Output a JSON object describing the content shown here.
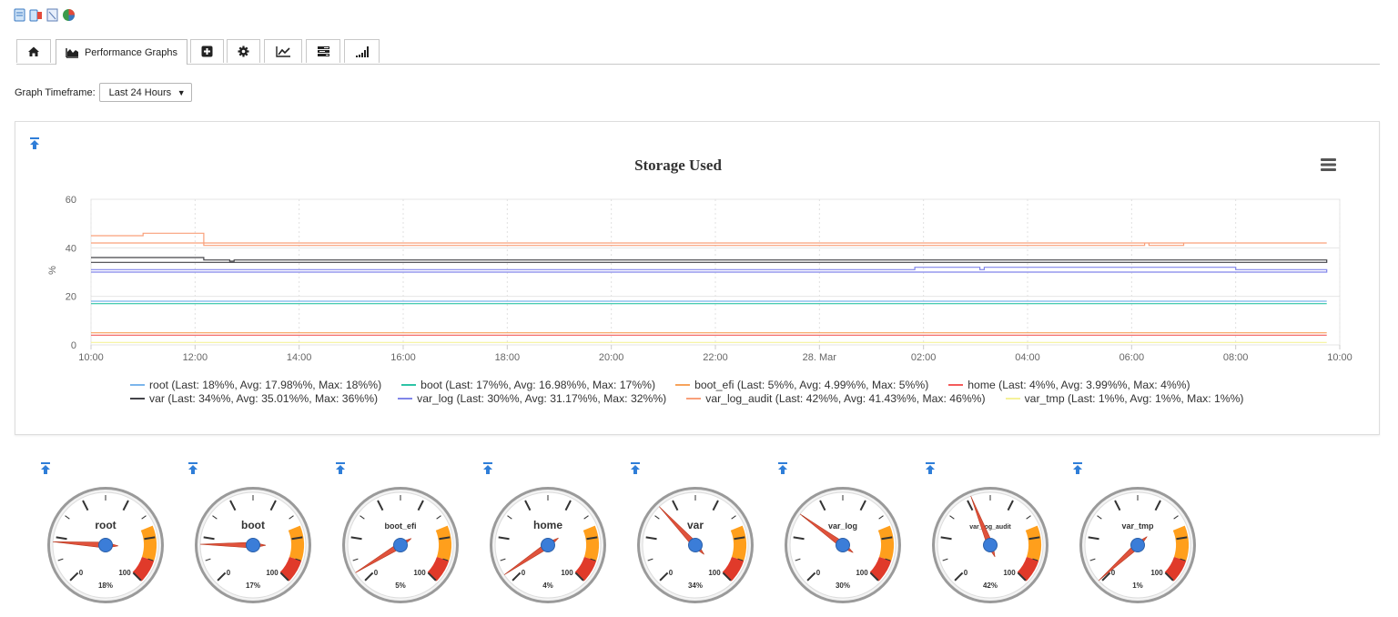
{
  "tabs": [
    {
      "icon": "home-icon",
      "label": ""
    },
    {
      "icon": "area-chart-icon",
      "label": "Performance Graphs"
    },
    {
      "icon": "plus-square-icon",
      "label": ""
    },
    {
      "icon": "gear-icon",
      "label": ""
    },
    {
      "icon": "line-chart-icon",
      "label": ""
    },
    {
      "icon": "tasks-icon",
      "label": ""
    },
    {
      "icon": "signal-bars-icon",
      "label": ""
    }
  ],
  "timeframe": {
    "label": "Graph Timeframe:",
    "selected": "Last 24 Hours"
  },
  "chart_data": [
    {
      "type": "line",
      "title": "Storage Used",
      "xlabel": "",
      "ylabel": "%",
      "ylim": [
        0,
        60
      ],
      "yticks": [
        "0",
        "20",
        "40",
        "60"
      ],
      "xticks": [
        "10:00",
        "12:00",
        "14:00",
        "16:00",
        "18:00",
        "20:00",
        "22:00",
        "28. Mar",
        "02:00",
        "04:00",
        "06:00",
        "08:00",
        "10:00"
      ],
      "x": [
        "10:00",
        "10:45",
        "11:00",
        "11:10",
        "12:00",
        "12:10",
        "12:15",
        "12:40",
        "12:45",
        "13:00",
        "14:00",
        "16:00",
        "18:00",
        "20:00",
        "22:00",
        "00:00",
        "01:45",
        "01:50",
        "02:00",
        "03:00",
        "03:05",
        "03:10",
        "03:15",
        "04:00",
        "06:00",
        "06:15",
        "06:20",
        "06:30",
        "06:45",
        "07:00",
        "07:15",
        "08:00",
        "09:45",
        "10:00",
        "10:15"
      ],
      "series": [
        {
          "name": "root",
          "color": "#7cb5ec",
          "values": [
            18,
            18,
            18,
            18,
            18,
            18,
            18,
            18,
            18,
            18,
            18,
            18,
            18,
            18,
            18,
            18,
            18,
            18,
            18,
            18,
            18,
            18,
            18,
            18,
            18,
            18,
            18,
            18,
            18,
            18,
            18,
            18,
            18,
            18,
            18
          ]
        },
        {
          "name": "boot",
          "color": "#2ec4a6",
          "values": [
            17,
            17,
            17,
            17,
            17,
            17,
            17,
            17,
            17,
            17,
            17,
            17,
            17,
            17,
            17,
            17,
            17,
            17,
            17,
            17,
            17,
            17,
            17,
            17,
            17,
            17,
            17,
            17,
            17,
            17,
            17,
            17,
            17,
            17,
            17
          ]
        },
        {
          "name": "boot_efi",
          "color": "#f7a35c",
          "values": [
            5,
            5,
            5,
            5,
            5,
            5,
            5,
            5,
            5,
            5,
            5,
            5,
            5,
            5,
            5,
            5,
            5,
            5,
            5,
            5,
            5,
            5,
            5,
            5,
            5,
            5,
            5,
            5,
            5,
            5,
            5,
            5,
            5,
            5,
            5
          ]
        },
        {
          "name": "home",
          "color": "#f45b5b",
          "values": [
            4,
            4,
            4,
            4,
            4,
            4,
            4,
            4,
            4,
            4,
            4,
            4,
            4,
            4,
            4,
            4,
            4,
            4,
            4,
            4,
            4,
            4,
            4,
            4,
            4,
            4,
            4,
            4,
            4,
            4,
            4,
            4,
            4,
            4,
            4
          ]
        },
        {
          "name": "var",
          "color": "#434348",
          "values": [
            36,
            36,
            36,
            36,
            36,
            35,
            35,
            34.5,
            35,
            35,
            35,
            35,
            35,
            35,
            35,
            35,
            35,
            35,
            35,
            35,
            35,
            35,
            35,
            35,
            35,
            35,
            35,
            35,
            35,
            35,
            35,
            35,
            34,
            34,
            34
          ]
        },
        {
          "name": "var_log",
          "color": "#8085e9",
          "values": [
            31,
            31,
            31,
            31,
            31,
            31,
            31,
            31,
            31,
            31,
            31,
            31,
            31,
            31,
            31,
            31,
            31,
            32,
            32,
            32,
            31,
            32,
            32,
            32,
            32,
            32,
            32,
            32,
            32,
            32,
            32,
            31,
            30,
            30,
            30
          ]
        },
        {
          "name": "var_log_audit",
          "color": "#f9a07a",
          "values": [
            45,
            45,
            46,
            46,
            46,
            41,
            41,
            41,
            41,
            41,
            41,
            41,
            41,
            41,
            41,
            41,
            41,
            41,
            41,
            41,
            41,
            41,
            41,
            41,
            41,
            42,
            41,
            41,
            41,
            42,
            42,
            42,
            42,
            42,
            42
          ]
        },
        {
          "name": "var_tmp",
          "color": "#f5f29a",
          "values": [
            1,
            1,
            1,
            1,
            1,
            1,
            1,
            1,
            1,
            1,
            1,
            1,
            1,
            1,
            1,
            1,
            1,
            1,
            1,
            1,
            1,
            1,
            1,
            1,
            1,
            1,
            1,
            1,
            1,
            1,
            1,
            1,
            1,
            1,
            1
          ]
        }
      ],
      "legend": [
        "root (Last: 18%%, Avg: 17.98%%, Max: 18%%)",
        "boot (Last: 17%%, Avg: 16.98%%, Max: 17%%)",
        "boot_efi (Last: 5%%, Avg: 4.99%%, Max: 5%%)",
        "home (Last: 4%%, Avg: 3.99%%, Max: 4%%)",
        "var (Last: 34%%, Avg: 35.01%%, Max: 36%%)",
        "var_log (Last: 30%%, Avg: 31.17%%, Max: 32%%)",
        "var_log_audit (Last: 42%%, Avg: 41.43%%, Max: 46%%)",
        "var_tmp (Last: 1%%, Avg: 1%%, Max: 1%%)"
      ],
      "legend_placement": "bottom",
      "grid": true
    },
    {
      "type": "gauge",
      "min": 0,
      "max": 100,
      "min_label": "0",
      "max_label": "100",
      "gauges": [
        {
          "name": "root",
          "value": 18,
          "label": "18%"
        },
        {
          "name": "boot",
          "value": 17,
          "label": "17%"
        },
        {
          "name": "boot_efi",
          "value": 5,
          "label": "5%"
        },
        {
          "name": "home",
          "value": 4,
          "label": "4%"
        },
        {
          "name": "var",
          "value": 34,
          "label": "34%"
        },
        {
          "name": "var_log",
          "value": 30,
          "label": "30%"
        },
        {
          "name": "var_log_audit",
          "value": 42,
          "label": "42%"
        },
        {
          "name": "var_tmp",
          "value": 1,
          "label": "1%"
        }
      ]
    }
  ]
}
